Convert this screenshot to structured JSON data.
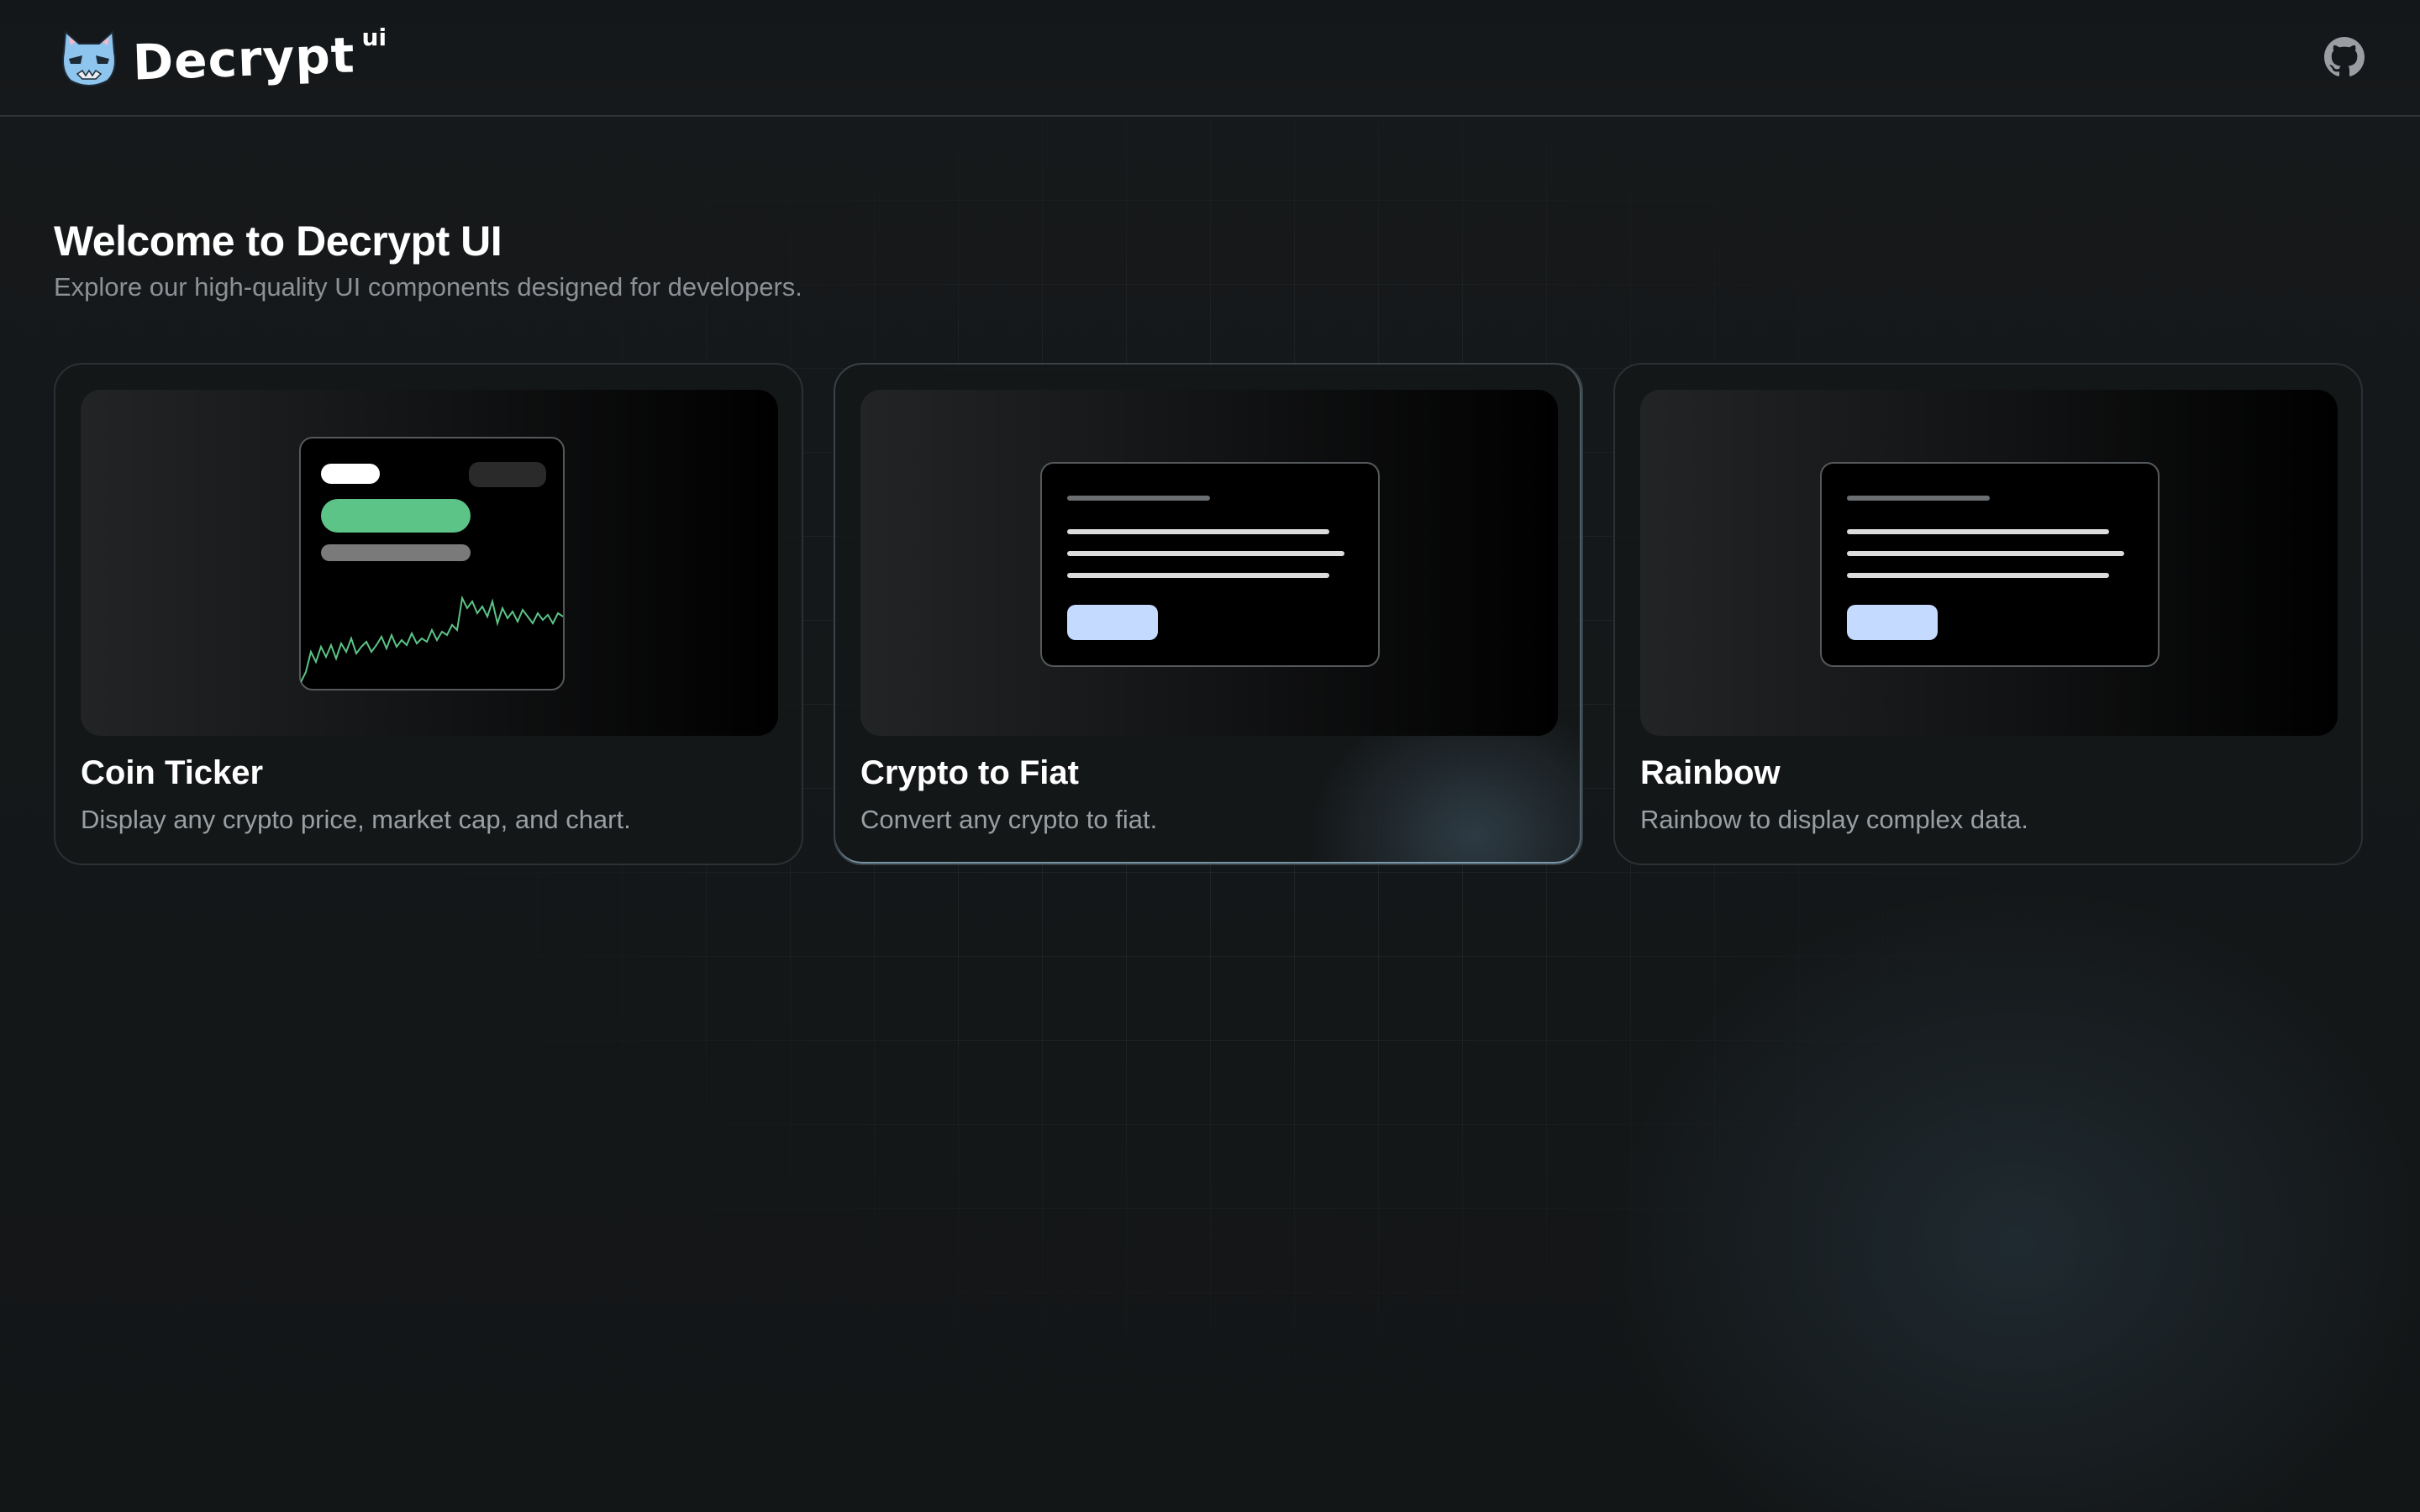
{
  "header": {
    "logo_text": "Decrypt",
    "logo_sup": "ui",
    "logo_icon": "cat-mascot-icon",
    "github_icon": "github-icon"
  },
  "hero": {
    "title": "Welcome to Decrypt UI",
    "subtitle": "Explore our high-quality UI components designed for developers."
  },
  "cards": [
    {
      "title": "Coin Ticker",
      "description": "Display any crypto price, market cap, and chart.",
      "preview": "coin-ticker-preview"
    },
    {
      "title": "Crypto to Fiat",
      "description": "Convert any crypto to fiat.",
      "preview": "converter-preview"
    },
    {
      "title": "Rainbow",
      "description": "Rainbow to display complex data.",
      "preview": "rainbow-preview"
    }
  ],
  "colors": {
    "accent_green": "#5cc487",
    "accent_blue": "#c5daff",
    "background": "#131617"
  }
}
